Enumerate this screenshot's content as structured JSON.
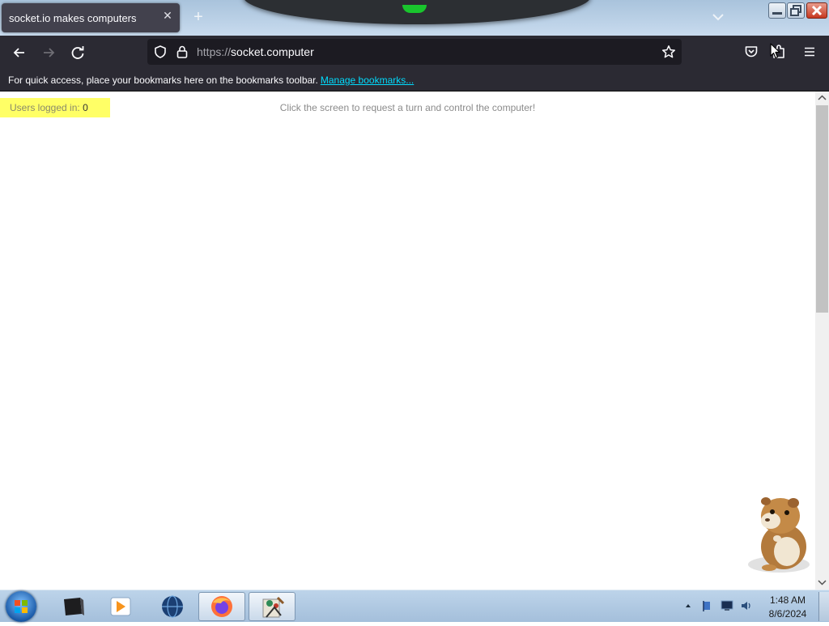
{
  "browser": {
    "tab_title": "socket.io makes computers",
    "url_scheme": "https://",
    "url_host": "socket.computer",
    "bookmarks_message": "For quick access, place your bookmarks here on the bookmarks toolbar.",
    "bookmarks_link": "Manage bookmarks..."
  },
  "page": {
    "users_label": "Users logged in:",
    "users_count": "0",
    "hint": "Click the screen to request a turn and control the computer!"
  },
  "taskbar": {
    "apps": [
      "terminal-icon",
      "media-player-icon",
      "globe-icon",
      "firefox-icon",
      "paint-icon"
    ],
    "active_apps": [
      "firefox-icon",
      "paint-icon"
    ],
    "time": "1:48 AM",
    "date": "8/6/2024"
  },
  "colors": {
    "badge_bg": "#ffff66",
    "toolbar_bg": "#2b2a33",
    "link": "#00ddff"
  }
}
